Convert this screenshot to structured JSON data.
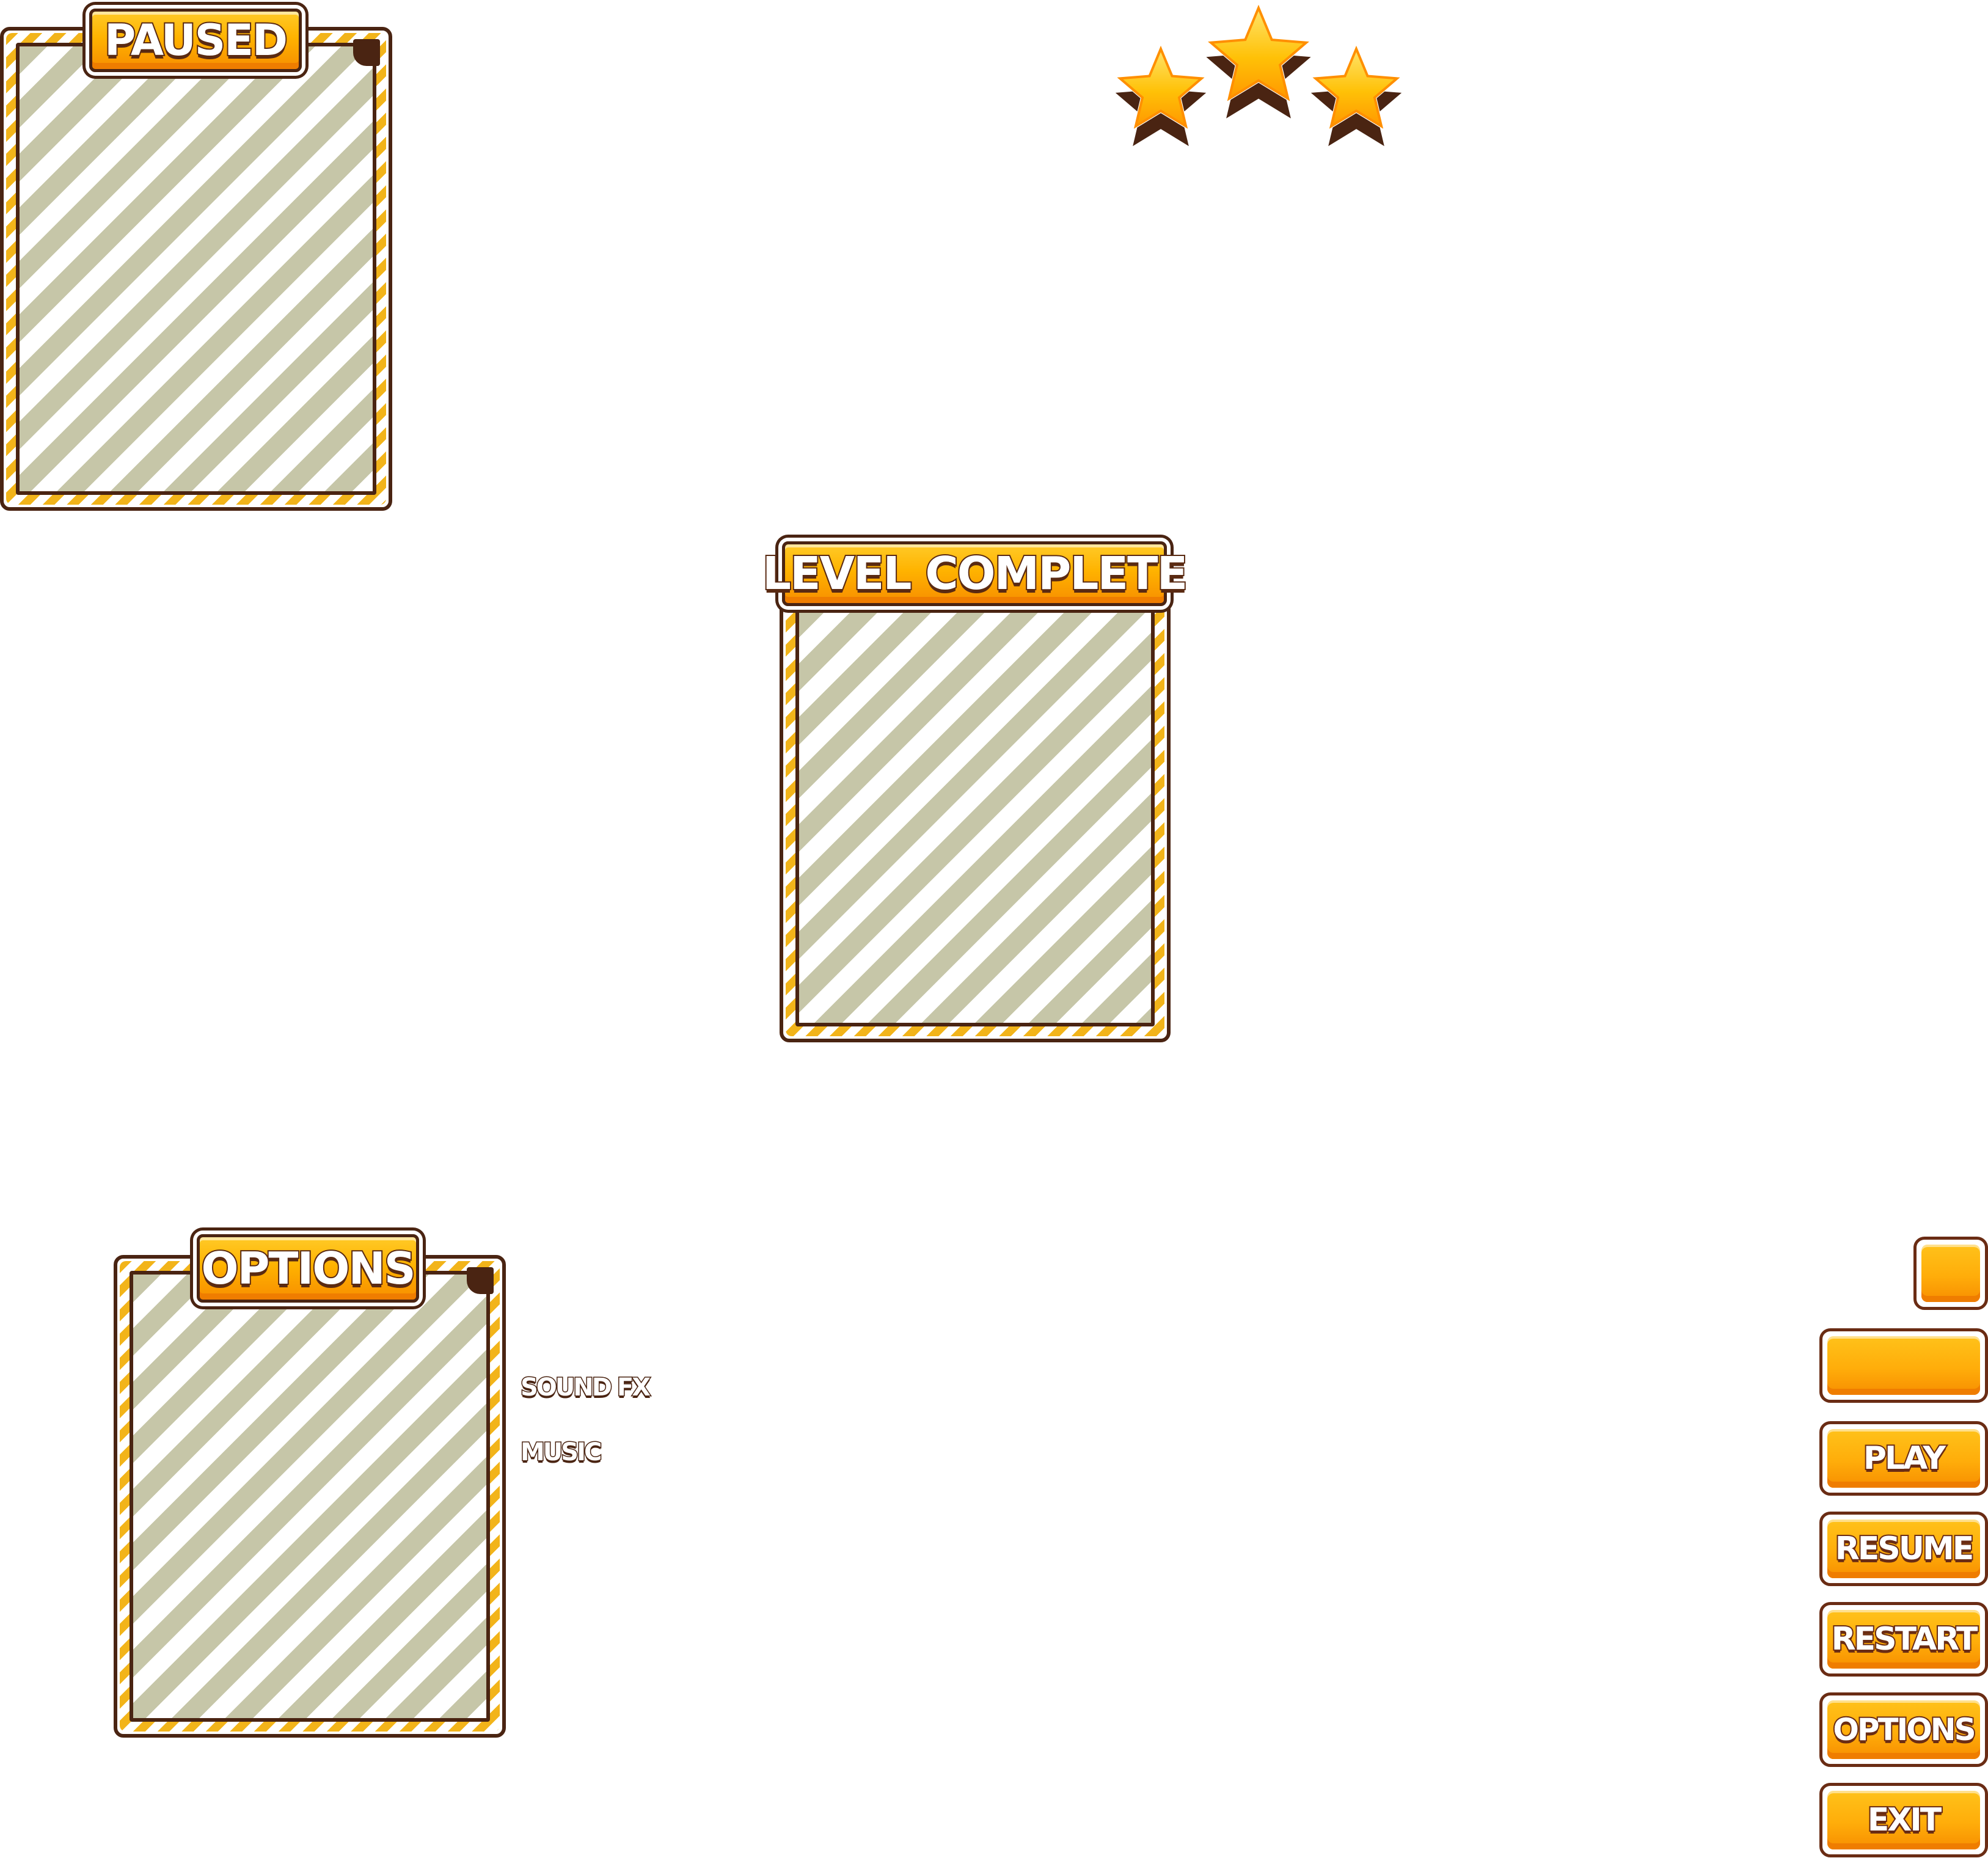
{
  "panels": {
    "paused": {
      "title": "PAUSED"
    },
    "level_complete": {
      "title": "LEVEL COMPLETE"
    },
    "options": {
      "title": "OPTIONS",
      "labels": {
        "sound_fx": "SOUND FX",
        "music": "MUSIC"
      }
    }
  },
  "rating": {
    "stars": 3,
    "max": 3
  },
  "buttons": {
    "play": "PLAY",
    "resume": "RESUME",
    "restart": "RESTART",
    "options": "OPTIONS",
    "exit": "EXIT"
  },
  "colors": {
    "outline": "#4a2412",
    "button_orange": "#ffad0a",
    "stripe": "#c6c6a8",
    "rope_gold": "#f2b41a",
    "star_gold": "#ffc107"
  }
}
